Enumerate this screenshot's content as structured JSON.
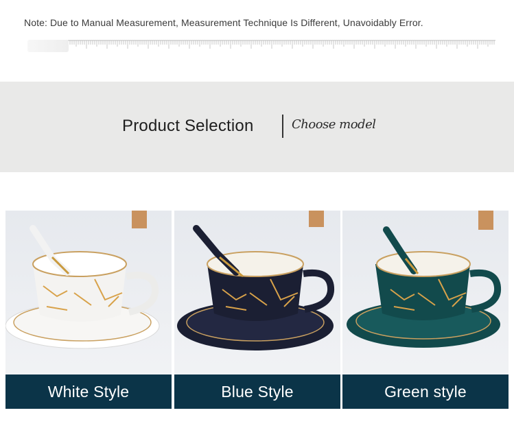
{
  "note": "Note: Due to Manual Measurement, Measurement Technique Is Different, Unavoidably Error.",
  "section": {
    "title": "Product Selection",
    "subtitle": "Choose model"
  },
  "products": [
    {
      "label": "White Style",
      "cup_color": "#f4f3f1",
      "accent": "#d8a24a"
    },
    {
      "label": "Blue Style",
      "cup_color": "#1b1f33",
      "accent": "#d8a24a"
    },
    {
      "label": "Green style",
      "cup_color": "#124a4c",
      "accent": "#d8a24a"
    }
  ],
  "colors": {
    "band_bg": "#e9e9e8",
    "label_bar": "#0b3448",
    "gold": "#d8a24a"
  }
}
